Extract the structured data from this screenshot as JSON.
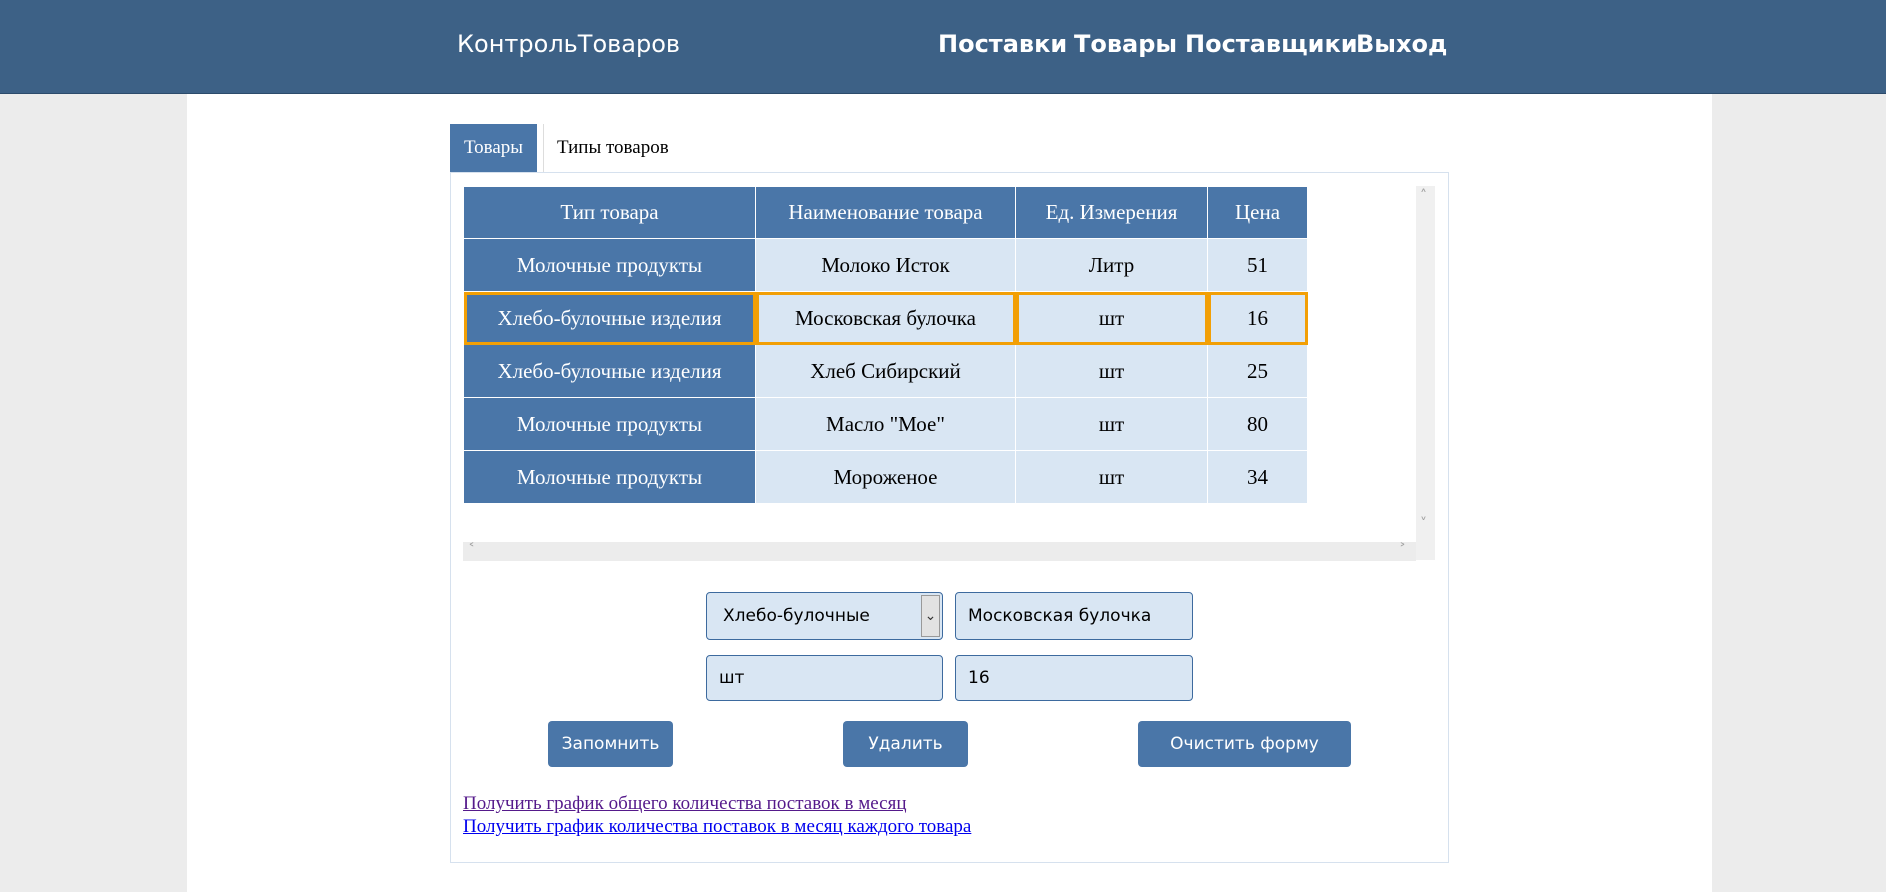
{
  "navbar": {
    "brand": "КонтрольТоваров",
    "items": [
      "Поставки",
      "Товары",
      "Поставщики",
      "Выход"
    ]
  },
  "tabs": [
    {
      "label": "Товары",
      "active": true
    },
    {
      "label": "Типы товаров",
      "active": false
    }
  ],
  "table": {
    "columns": [
      "Тип товара",
      "Наименование товара",
      "Ед. Измерения",
      "Цена"
    ],
    "rows": [
      [
        "Молочные продукты",
        "Молоко Исток",
        "Литр",
        "51"
      ],
      [
        "Хлебо-булочные изделия",
        "Московская булочка",
        "шт",
        "16"
      ],
      [
        "Хлебо-булочные изделия",
        "Хлеб Сибирский",
        "шт",
        "25"
      ],
      [
        "Молочные продукты",
        "Масло \"Мое\"",
        "шт",
        "80"
      ],
      [
        "Молочные продукты",
        "Мороженое",
        "шт",
        "34"
      ]
    ],
    "selected_row": 1
  },
  "form": {
    "type_select": "Хлебо-булочные изделия",
    "name": "Московская булочка",
    "unit": "шт",
    "price": "16"
  },
  "buttons": {
    "save": "Запомнить",
    "delete": "Удалить",
    "clear": "Очистить форму"
  },
  "links": {
    "total_chart": "Получить график общего количества поставок в месяц",
    "per_item_chart": "Получить график количества поставок в месяц каждого товара"
  },
  "colors": {
    "navbar": "#3d6186",
    "accent": "#4a76a8",
    "cell_light": "#d9e6f3",
    "selection": "#f29f05"
  }
}
